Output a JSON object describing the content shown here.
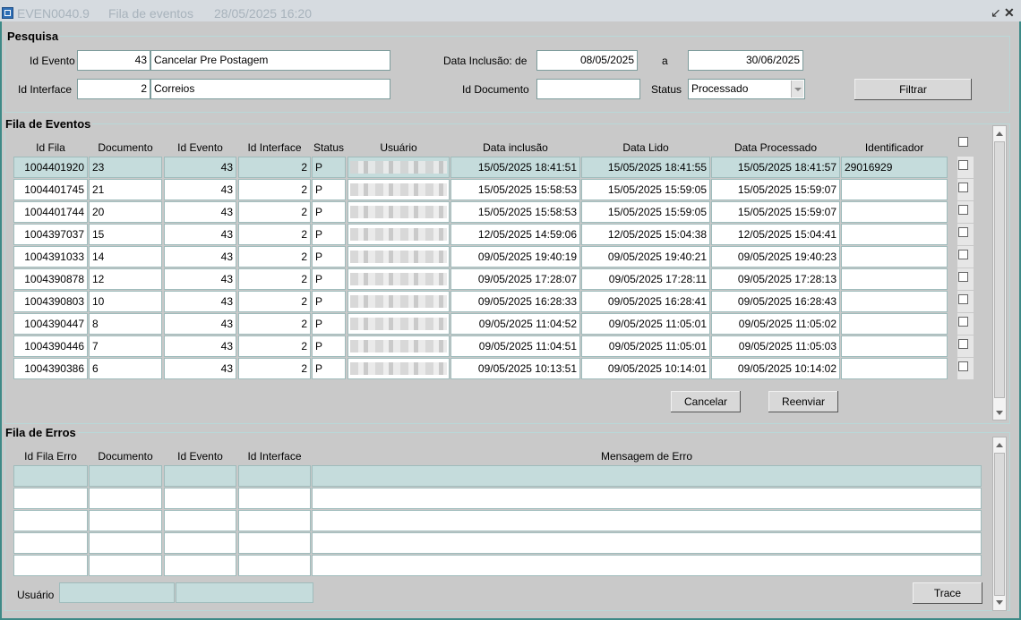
{
  "window": {
    "form_id": "EVEN0040.9",
    "title": "Fila de eventos",
    "datetime": "28/05/2025 16:20"
  },
  "pesquisa": {
    "label": "Pesquisa",
    "id_evento_label": "Id Evento",
    "id_evento_value": "43",
    "id_evento_desc": "Cancelar Pre Postagem",
    "id_interface_label": "Id Interface",
    "id_interface_value": "2",
    "id_interface_desc": "Correios",
    "data_inclusao_label": "Data Inclusão: de",
    "data_de": "08/05/2025",
    "a_label": "a",
    "data_ate": "30/06/2025",
    "id_documento_label": "Id Documento",
    "id_documento_value": "",
    "status_label": "Status",
    "status_value": "Processado",
    "filtrar_label": "Filtrar"
  },
  "fila_eventos": {
    "label": "Fila de Eventos",
    "headers": [
      "Id Fila",
      "Documento",
      "Id Evento",
      "Id Interface",
      "Status",
      "Usuário",
      "Data inclusão",
      "Data Lido",
      "Data Processado",
      "Identificador"
    ],
    "rows": [
      {
        "id_fila": "1004401920",
        "documento": "23",
        "id_evento": "43",
        "id_interface": "2",
        "status": "P",
        "data_inclusao": "15/05/2025 18:41:51",
        "data_lido": "15/05/2025 18:41:55",
        "data_processado": "15/05/2025 18:41:57",
        "identificador": "29016929",
        "selected": true
      },
      {
        "id_fila": "1004401745",
        "documento": "21",
        "id_evento": "43",
        "id_interface": "2",
        "status": "P",
        "data_inclusao": "15/05/2025 15:58:53",
        "data_lido": "15/05/2025 15:59:05",
        "data_processado": "15/05/2025 15:59:07",
        "identificador": ""
      },
      {
        "id_fila": "1004401744",
        "documento": "20",
        "id_evento": "43",
        "id_interface": "2",
        "status": "P",
        "data_inclusao": "15/05/2025 15:58:53",
        "data_lido": "15/05/2025 15:59:05",
        "data_processado": "15/05/2025 15:59:07",
        "identificador": ""
      },
      {
        "id_fila": "1004397037",
        "documento": "15",
        "id_evento": "43",
        "id_interface": "2",
        "status": "P",
        "data_inclusao": "12/05/2025 14:59:06",
        "data_lido": "12/05/2025 15:04:38",
        "data_processado": "12/05/2025 15:04:41",
        "identificador": ""
      },
      {
        "id_fila": "1004391033",
        "documento": "14",
        "id_evento": "43",
        "id_interface": "2",
        "status": "P",
        "data_inclusao": "09/05/2025 19:40:19",
        "data_lido": "09/05/2025 19:40:21",
        "data_processado": "09/05/2025 19:40:23",
        "identificador": ""
      },
      {
        "id_fila": "1004390878",
        "documento": "12",
        "id_evento": "43",
        "id_interface": "2",
        "status": "P",
        "data_inclusao": "09/05/2025 17:28:07",
        "data_lido": "09/05/2025 17:28:11",
        "data_processado": "09/05/2025 17:28:13",
        "identificador": ""
      },
      {
        "id_fila": "1004390803",
        "documento": "10",
        "id_evento": "43",
        "id_interface": "2",
        "status": "P",
        "data_inclusao": "09/05/2025 16:28:33",
        "data_lido": "09/05/2025 16:28:41",
        "data_processado": "09/05/2025 16:28:43",
        "identificador": ""
      },
      {
        "id_fila": "1004390447",
        "documento": "8",
        "id_evento": "43",
        "id_interface": "2",
        "status": "P",
        "data_inclusao": "09/05/2025 11:04:52",
        "data_lido": "09/05/2025 11:05:01",
        "data_processado": "09/05/2025 11:05:02",
        "identificador": ""
      },
      {
        "id_fila": "1004390446",
        "documento": "7",
        "id_evento": "43",
        "id_interface": "2",
        "status": "P",
        "data_inclusao": "09/05/2025 11:04:51",
        "data_lido": "09/05/2025 11:05:01",
        "data_processado": "09/05/2025 11:05:03",
        "identificador": ""
      },
      {
        "id_fila": "1004390386",
        "documento": "6",
        "id_evento": "43",
        "id_interface": "2",
        "status": "P",
        "data_inclusao": "09/05/2025 10:13:51",
        "data_lido": "09/05/2025 10:14:01",
        "data_processado": "09/05/2025 10:14:02",
        "identificador": ""
      }
    ],
    "cancelar_label": "Cancelar",
    "reenviar_label": "Reenviar"
  },
  "fila_erros": {
    "label": "Fila de Erros",
    "headers": [
      "Id Fila Erro",
      "Documento",
      "Id Evento",
      "Id Interface",
      "Mensagem de Erro"
    ],
    "row_count": 5,
    "usuario_label": "Usuário",
    "trace_label": "Trace"
  },
  "icons": {
    "app": "form-window-icon",
    "minimize": "minimize-icon",
    "close": "close-icon"
  },
  "colors": {
    "frame_border": "#3e8a87",
    "selected_row": "#c5dcdc",
    "background": "#c9c9c9"
  }
}
